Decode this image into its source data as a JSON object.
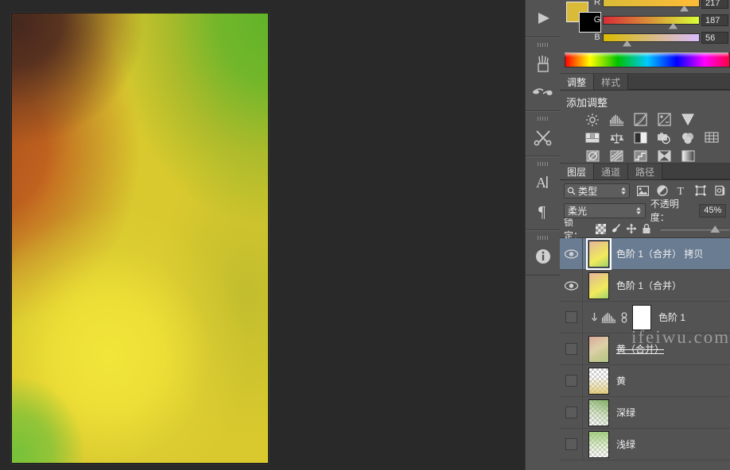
{
  "document": {
    "canvas_description": "gradient artwork: dark brown top-left, green top-right, orange left, yellow bottom"
  },
  "dock": {
    "items": [
      {
        "name": "play-icon",
        "label": "动作"
      },
      {
        "name": "brushes-icon",
        "label": "画笔"
      },
      {
        "name": "tool-presets-icon",
        "label": "工具预设"
      },
      {
        "name": "tools-icon",
        "label": "工具"
      },
      {
        "name": "character-icon",
        "label": "字符"
      },
      {
        "name": "paragraph-icon",
        "label": "段落"
      },
      {
        "name": "info-icon",
        "label": "信息"
      }
    ]
  },
  "color_panel": {
    "foreground_color": "#d9bb38",
    "background_color": "#000000",
    "sliders": [
      {
        "label": "R",
        "value": "217",
        "thumb_pct": 85
      },
      {
        "label": "G",
        "value": "187",
        "thumb_pct": 73
      },
      {
        "label": "B",
        "value": "56",
        "thumb_pct": 22
      }
    ]
  },
  "adjustments_panel": {
    "tabs": [
      {
        "label": "调整",
        "active": true
      },
      {
        "label": "样式",
        "active": false
      }
    ],
    "title": "添加调整",
    "icons": [
      [
        "brightness-contrast-icon",
        "levels-icon",
        "curves-icon",
        "exposure-icon",
        "vibrance-icon"
      ],
      [
        "hue-saturation-icon",
        "color-balance-icon",
        "black-white-icon",
        "photo-filter-icon",
        "channel-mixer-icon",
        "color-lookup-icon"
      ],
      [
        "invert-icon",
        "posterize-icon",
        "threshold-icon",
        "selective-color-icon",
        "gradient-map-icon"
      ]
    ]
  },
  "layers_panel": {
    "tabs": [
      {
        "label": "图层",
        "active": true
      },
      {
        "label": "通道",
        "active": false
      },
      {
        "label": "路径",
        "active": false
      }
    ],
    "filter": {
      "kind_label": "类型",
      "icons": [
        "pixel-filter-icon",
        "adjustment-filter-icon",
        "type-filter-icon",
        "shape-filter-icon",
        "smart-object-filter-icon"
      ]
    },
    "blend_mode": "柔光",
    "opacity_label": "不透明度：",
    "opacity_value": "45%",
    "lock_label": "锁定：",
    "lock_icons": [
      "lock-transparency-icon",
      "lock-image-icon",
      "lock-position-icon",
      "lock-all-icon"
    ],
    "layers": [
      {
        "name": "色阶 1（合并） 拷贝",
        "visible": true,
        "selected": true,
        "type": "pixel",
        "thumb": "gradient"
      },
      {
        "name": "色阶 1（合并）",
        "visible": true,
        "selected": false,
        "type": "pixel",
        "thumb": "gradient"
      },
      {
        "name": "色阶 1",
        "visible": false,
        "selected": false,
        "type": "adjustment",
        "thumb": "mask",
        "clipped": true
      },
      {
        "name": "黄（合并）",
        "visible": false,
        "selected": false,
        "type": "pixel",
        "thumb": "gradient",
        "struck": true
      },
      {
        "name": "黄",
        "visible": false,
        "selected": false,
        "type": "pixel",
        "thumb": "checker-yellow"
      },
      {
        "name": "深绿",
        "visible": false,
        "selected": false,
        "type": "pixel",
        "thumb": "checker-green"
      },
      {
        "name": "浅绿",
        "visible": false,
        "selected": false,
        "type": "pixel",
        "thumb": "checker-lightgreen"
      }
    ]
  },
  "watermark": {
    "text": "ifeiwu.com"
  }
}
